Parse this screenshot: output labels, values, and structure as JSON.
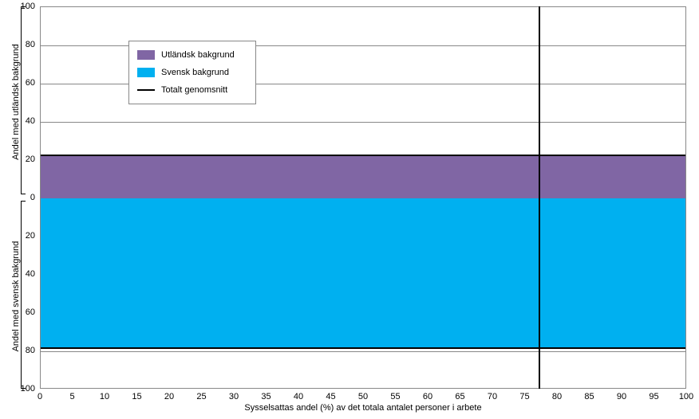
{
  "chart_data": {
    "type": "area",
    "title": "",
    "xlabel": "Sysselsattas andel (%) av det totala antalet personer i arbete",
    "ylabel_top": "Andel med utländsk bakgrund",
    "ylabel_bottom": "Andel med svensk bakgrund",
    "x_range": [
      0,
      100
    ],
    "x_ticks": [
      0,
      5,
      10,
      15,
      20,
      25,
      30,
      35,
      40,
      45,
      50,
      55,
      60,
      65,
      70,
      75,
      80,
      85,
      90,
      95,
      100
    ],
    "y_top_range": [
      0,
      100
    ],
    "y_top_ticks": [
      0,
      20,
      40,
      60,
      80,
      100
    ],
    "y_bottom_range": [
      0,
      100
    ],
    "y_bottom_ticks": [
      20,
      40,
      60,
      80,
      100
    ],
    "series": [
      {
        "name": "Utländsk bakgrund",
        "color": "#8066a4",
        "x": [
          0,
          100
        ],
        "y": [
          22,
          22
        ],
        "axis": "top"
      },
      {
        "name": "Svensk bakgrund",
        "color": "#00b0f0",
        "x": [
          0,
          100
        ],
        "y": [
          78,
          78
        ],
        "axis": "bottom"
      }
    ],
    "reference_line": {
      "name": "Totalt genomsnitt",
      "x": 77
    },
    "legend": {
      "items": [
        {
          "label": "Utländsk bakgrund",
          "type": "swatch",
          "color": "#8066a4"
        },
        {
          "label": "Svensk bakgrund",
          "type": "swatch",
          "color": "#00b0f0"
        },
        {
          "label": "Totalt genomsnitt",
          "type": "line",
          "color": "#000"
        }
      ]
    }
  }
}
